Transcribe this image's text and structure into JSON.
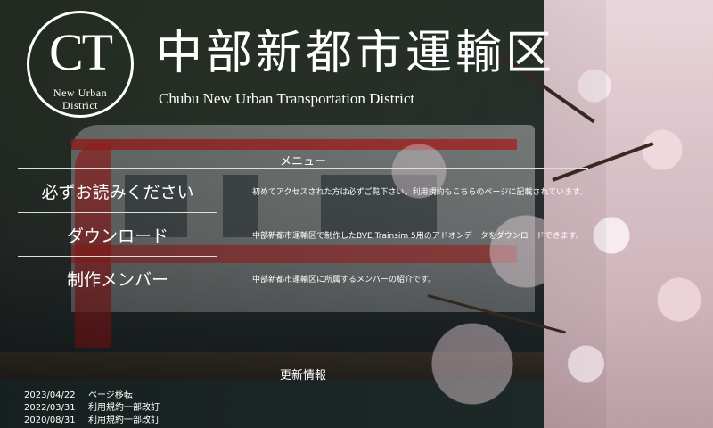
{
  "logo": {
    "letters": "CT",
    "line1": "New Urban",
    "line2": "District"
  },
  "header": {
    "title": "中部新都市運輸区",
    "subtitle": "Chubu New Urban Transportation District"
  },
  "menu": {
    "heading": "メニュー",
    "items": [
      {
        "label": "必ずお読みください",
        "desc": "初めてアクセスされた方は必ずご覧下さい。利用規約もこちらのページに記載されています。"
      },
      {
        "label": "ダウンロード",
        "desc": "中部新都市運輸区で制作したBVE Trainsim 5用のアドオンデータをダウンロードできます。"
      },
      {
        "label": "制作メンバー",
        "desc": "中部新都市運輸区に所属するメンバーの紹介です。"
      }
    ]
  },
  "news": {
    "heading": "更新情報",
    "entries": [
      {
        "date": "2023/04/22",
        "text": "ページ移転"
      },
      {
        "date": "2022/03/31",
        "text": "利用規約一部改訂"
      },
      {
        "date": "2020/08/31",
        "text": "利用規約一部改訂"
      }
    ]
  }
}
